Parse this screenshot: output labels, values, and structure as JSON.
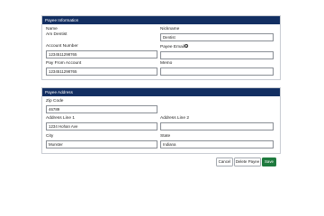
{
  "payee_information": {
    "title": "Payee Information",
    "name_label": "Name",
    "name_value": "Am Dentist",
    "nickname_label": "Nickname",
    "nickname_value": "Dentist",
    "account_number_label": "Account Number",
    "account_number_value": "1234511298765",
    "payee_email_label": "Payee Email",
    "payee_email_value": "",
    "pay_from_account_label": "Pay From Account",
    "pay_from_account_value": "1234511298765",
    "memo_label": "Memo",
    "memo_value": ""
  },
  "payee_address": {
    "title": "Payee Address",
    "zip_label": "Zip Code",
    "zip_value": "46789",
    "address1_label": "Address Line 1",
    "address1_value": "1234 Hohan Ave",
    "address2_label": "Address Line 2",
    "address2_value": "",
    "city_label": "City",
    "city_value": "Munster",
    "state_label": "State",
    "state_value": "Indiana"
  },
  "actions": {
    "cancel_label": "Cancel",
    "delete_label": "Delete Payee",
    "save_label": "Save"
  },
  "icons": {
    "email_info": "info-icon"
  },
  "colors": {
    "header": "#132f62",
    "save": "#1f7a3e"
  }
}
